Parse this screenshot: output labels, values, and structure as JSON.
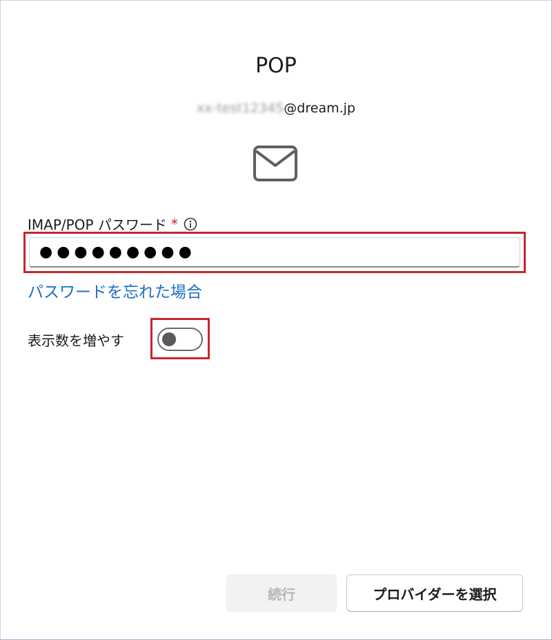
{
  "dialog": {
    "title": "POP",
    "account": {
      "redacted_name": "xx-test12345",
      "domain": "@dream.jp"
    },
    "mail_icon": "envelope-icon"
  },
  "password": {
    "label": "IMAP/POP パスワード",
    "required_marker": "*",
    "info_icon": "info-icon",
    "value": "●●●●●●●●●",
    "forgot_link": "パスワードを忘れた場合"
  },
  "more_options": {
    "label": "表示数を増やす",
    "toggle_on": false
  },
  "buttons": {
    "continue_label": "続行",
    "continue_disabled": true,
    "provider_label": "プロバイダーを選択"
  },
  "colors": {
    "highlight": "#c4262e",
    "link": "#1a6fc4"
  }
}
